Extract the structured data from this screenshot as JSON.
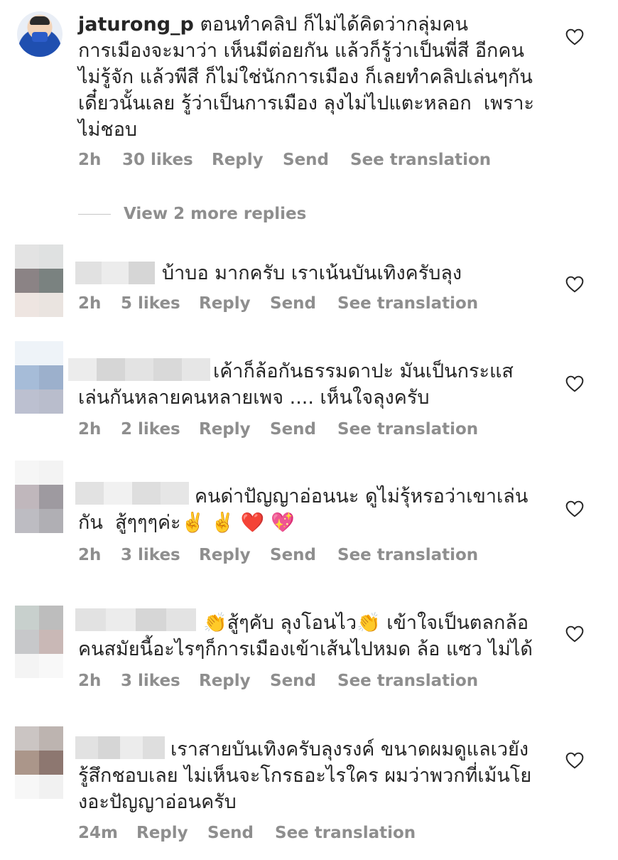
{
  "comments": [
    {
      "username": "jaturong_p",
      "text": "ตอนทำคลิป ก็ไม่ได้คิดว่ากลุ่มคนการเมืองจะมาว่า เห็นมีต่อยกัน แล้วก็รู้ว่าเป็นพี่สี อีกคนไม่รู้จัก แล้วพีสี ก็ไม่ใช่นักการเมือง ก็เลยทำคลิปเล่นๆกันเดี๋ยวนั้นเลย รู้ว่าเป็นการเมือง ลุงไม่ไปแตะหลอก  เพราะไม่ชอบ",
      "time": "2h",
      "likes": "30 likes",
      "reply": "Reply",
      "send": "Send",
      "translate": "See translation"
    },
    {
      "username": "",
      "text": "บ้าบอ มากครับ เราเน้นบันเทิงครับลุง",
      "time": "2h",
      "likes": "5 likes",
      "reply": "Reply",
      "send": "Send",
      "translate": "See translation"
    },
    {
      "username": "",
      "text": "เค้าก็ล้อกันธรรมดาปะ มันเป็นกระแสเล่นกันหลายคนหลายเพจ .... เห็นใจลุงครับ",
      "time": "2h",
      "likes": "2 likes",
      "reply": "Reply",
      "send": "Send",
      "translate": "See translation"
    },
    {
      "username": "",
      "text": "คนด่าปัญญาอ่อนนะ ดูไม่รุ้หรอว่าเขาเล่นกัน  สู้ๆๆๆค่ะ✌️ ✌️ ❤️ 💖",
      "time": "2h",
      "likes": "3 likes",
      "reply": "Reply",
      "send": "Send",
      "translate": "See translation"
    },
    {
      "username": "",
      "text": "👏สู้ๆคับ ลุงโอนไว👏 เข้าใจเป็นตลกล้อคนสมัยนี้อะไรๆก็การเมืองเข้าเส้นไปหมด ล้อ แซว ไม่ได้",
      "time": "2h",
      "likes": "3 likes",
      "reply": "Reply",
      "send": "Send",
      "translate": "See translation"
    },
    {
      "username": "",
      "text": "เราสายบันเทิงครับลุงรงค์ ขนาดผมดูแลเวยังรู้สึกชอบเลย ไม่เห็นจะโกรธอะไรใคร ผมว่าพวกที่เม้นโยงอะปัญญาอ่อนครับ",
      "time": "24m",
      "likes": "",
      "reply": "Reply",
      "send": "Send",
      "translate": "See translation"
    }
  ],
  "view_more": "View 2 more replies",
  "icons": {
    "like": "heart-outline-icon"
  },
  "colors": {
    "text": "#262626",
    "meta": "#8e8e8e"
  }
}
